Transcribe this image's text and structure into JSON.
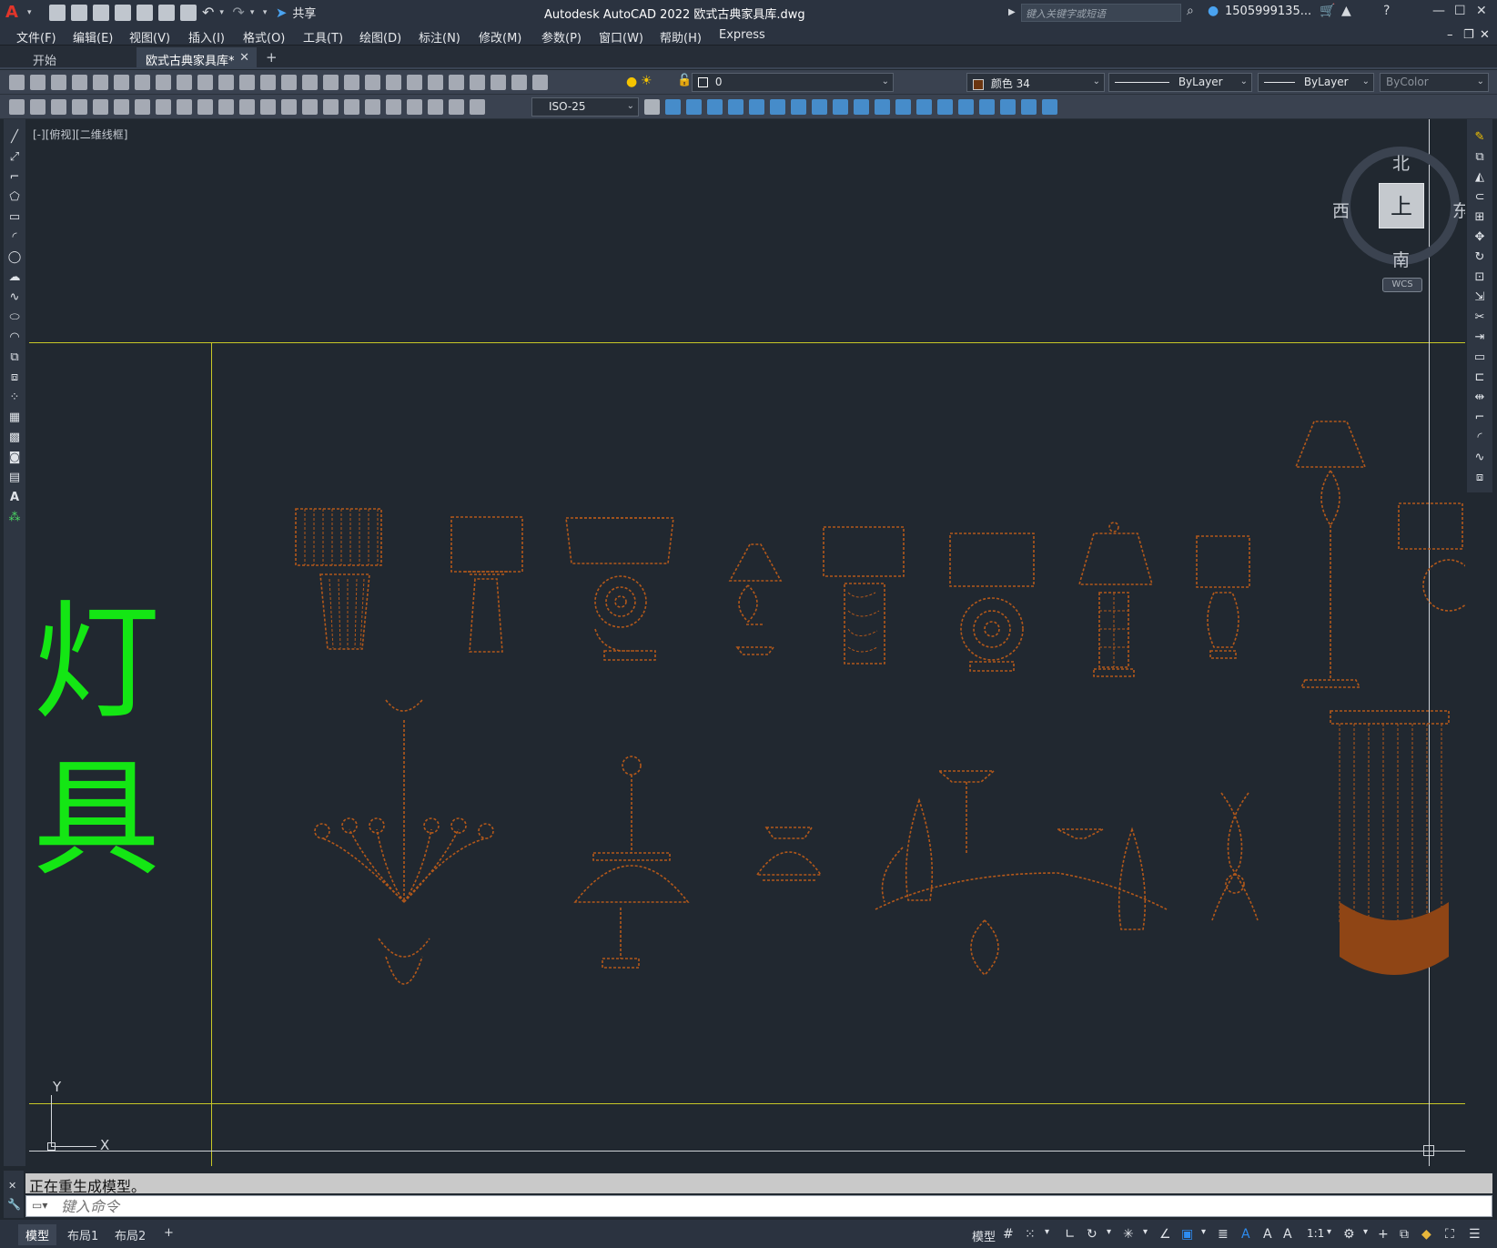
{
  "app": {
    "title": "Autodesk AutoCAD 2022    欧式古典家具库.dwg",
    "share_label": "共享",
    "app_icon": "A"
  },
  "search": {
    "placeholder": "键入关键字或短语"
  },
  "user": {
    "name": "1505999135..."
  },
  "menu": [
    "文件(F)",
    "编辑(E)",
    "视图(V)",
    "插入(I)",
    "格式(O)",
    "工具(T)",
    "绘图(D)",
    "标注(N)",
    "修改(M)",
    "参数(P)",
    "窗口(W)",
    "帮助(H)",
    "Express"
  ],
  "tabs": {
    "start": "开始",
    "doc": "欧式古典家具库*",
    "add": "+"
  },
  "properties": {
    "layer": "0",
    "color": "颜色 34",
    "linetype": "ByLayer",
    "lineweight": "ByLayer",
    "plotstyle": "ByColor",
    "dimstyle": "ISO-25"
  },
  "viewport": {
    "label": "[-][俯视][二维线框]"
  },
  "drawing": {
    "title_char_1": "灯",
    "title_char_2": "具",
    "ucs_x": "X",
    "ucs_y": "Y"
  },
  "viewcube": {
    "north": "北",
    "south": "南",
    "east": "东",
    "west": "西",
    "top": "上",
    "wcs": "WCS"
  },
  "command": {
    "history": "正在重生成模型。",
    "placeholder": "键入命令"
  },
  "layouts": [
    "模型",
    "布局1",
    "布局2"
  ],
  "status": {
    "model": "模型",
    "scale": "1:1"
  },
  "colors": {
    "accent_green": "#14e614",
    "line_yellow": "#c8c827",
    "drawing_orange": "#b3581a",
    "canvas": "#212830"
  }
}
